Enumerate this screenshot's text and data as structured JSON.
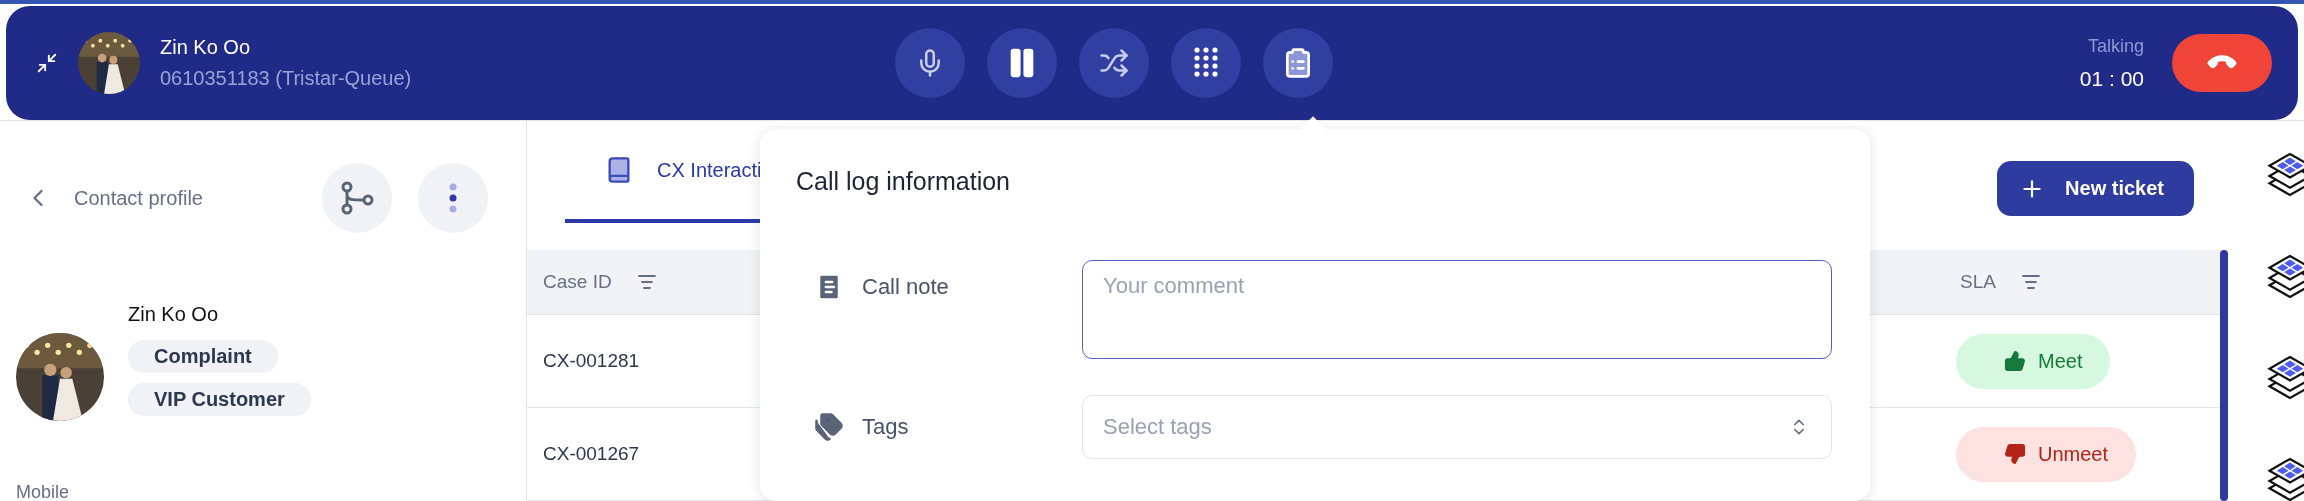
{
  "call_bar": {
    "contact_name": "Zin Ko Oo",
    "contact_line": "0610351183 (Tristar-Queue)",
    "controls": [
      {
        "kind": "mic"
      },
      {
        "kind": "pause"
      },
      {
        "kind": "transfer"
      },
      {
        "kind": "dialpad"
      },
      {
        "kind": "call_log"
      }
    ],
    "status": "Talking",
    "timer": "01 : 00"
  },
  "contact_panel": {
    "back_label": "Contact profile",
    "name": "Zin Ko Oo",
    "tags": [
      "Complaint",
      "VIP Customer"
    ],
    "field_label": "Mobile"
  },
  "main": {
    "tabs": [
      {
        "label": "CX Interacti",
        "selected": true
      }
    ],
    "new_ticket": "New ticket",
    "table": {
      "columns": [
        "Case ID",
        "SLA"
      ],
      "rows": [
        {
          "case_id": "CX-001281",
          "sla": {
            "label": "Meet",
            "kind": "meet"
          }
        },
        {
          "case_id": "CX-001267",
          "sla": {
            "label": "Unmeet",
            "kind": "unmeet"
          }
        }
      ]
    }
  },
  "popover": {
    "title": "Call log information",
    "fields": [
      {
        "kind": "textarea",
        "label": "Call note",
        "placeholder": "Your comment"
      },
      {
        "kind": "select",
        "label": "Tags",
        "placeholder": "Select tags"
      }
    ]
  }
}
